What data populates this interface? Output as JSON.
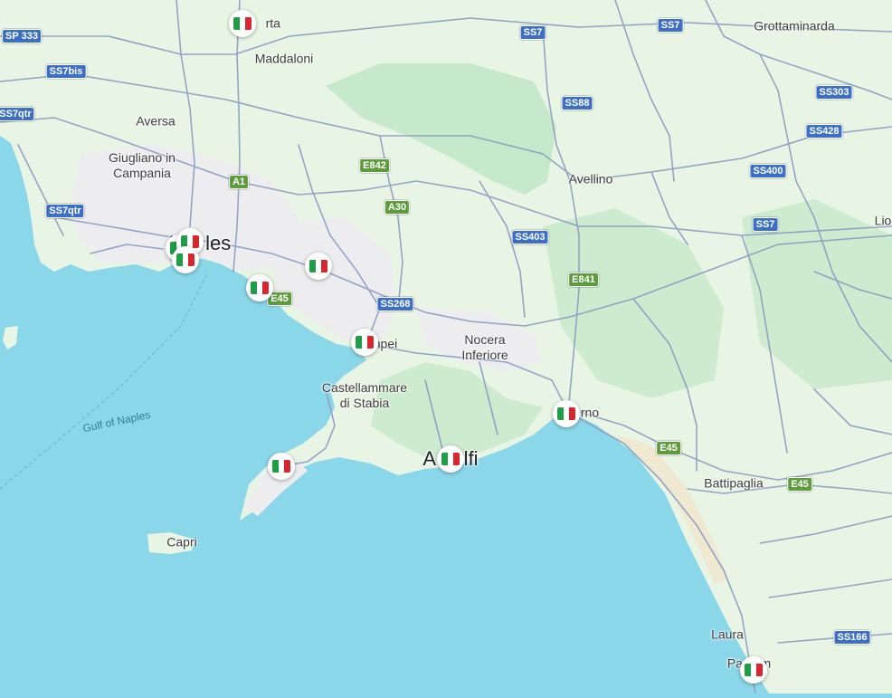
{
  "map": {
    "places": [
      {
        "name": "Ca",
        "suffix": "rta"
      },
      {
        "name": "Maddaloni"
      },
      {
        "name": "Grottaminarda"
      },
      {
        "name": "Aversa"
      },
      {
        "name": "Giugliano in\nCampania"
      },
      {
        "name": "Avellino"
      },
      {
        "name": "Lio"
      },
      {
        "name": "N",
        "suffix": "les"
      },
      {
        "name": "Nocera\nInferiore"
      },
      {
        "name": "npei"
      },
      {
        "name": "Castellammare\ndi Stabia"
      },
      {
        "name": "rno"
      },
      {
        "name": "A",
        "suffix": "lfi"
      },
      {
        "name": "Battipaglia"
      },
      {
        "name": "Capri"
      },
      {
        "name": "Laura"
      },
      {
        "name": "Pa",
        "suffix": "m"
      }
    ],
    "water_labels": [
      "Gulf of Naples"
    ],
    "road_shields": [
      {
        "label": "SP 333",
        "type": "ss"
      },
      {
        "label": "SS7bis",
        "type": "ss"
      },
      {
        "label": "SS7qtr",
        "type": "ss"
      },
      {
        "label": "SS7qtr",
        "type": "ss"
      },
      {
        "label": "SS7",
        "type": "ss"
      },
      {
        "label": "SS7",
        "type": "ss"
      },
      {
        "label": "SS88",
        "type": "ss"
      },
      {
        "label": "SS303",
        "type": "ss"
      },
      {
        "label": "SS428",
        "type": "ss"
      },
      {
        "label": "SS400",
        "type": "ss"
      },
      {
        "label": "SS7",
        "type": "ss"
      },
      {
        "label": "SS403",
        "type": "ss"
      },
      {
        "label": "SS268",
        "type": "ss"
      },
      {
        "label": "SS166",
        "type": "ss"
      },
      {
        "label": "A1",
        "type": "e"
      },
      {
        "label": "E842",
        "type": "e"
      },
      {
        "label": "A30",
        "type": "e"
      },
      {
        "label": "E841",
        "type": "e"
      },
      {
        "label": "E45",
        "type": "e"
      },
      {
        "label": "E45",
        "type": "e"
      },
      {
        "label": "E45",
        "type": "e"
      }
    ],
    "markers": [
      {
        "icon": "italy-flag-icon"
      },
      {
        "icon": "italy-flag-icon"
      },
      {
        "icon": "italy-flag-icon"
      },
      {
        "icon": "italy-flag-icon"
      },
      {
        "icon": "italy-flag-icon"
      },
      {
        "icon": "italy-flag-icon"
      },
      {
        "icon": "italy-flag-icon"
      },
      {
        "icon": "italy-flag-icon"
      },
      {
        "icon": "italy-flag-icon"
      },
      {
        "icon": "italy-flag-icon"
      },
      {
        "icon": "italy-flag-icon"
      }
    ],
    "colors": {
      "sea": "#8bd7ea",
      "land": "#e9f5e4",
      "forest": "#b9e3c1",
      "urban": "#eeeef0",
      "road": "#8f9fc5",
      "flag_green": "#1f9e48",
      "flag_white": "#ffffff",
      "flag_red": "#d8262f"
    }
  }
}
